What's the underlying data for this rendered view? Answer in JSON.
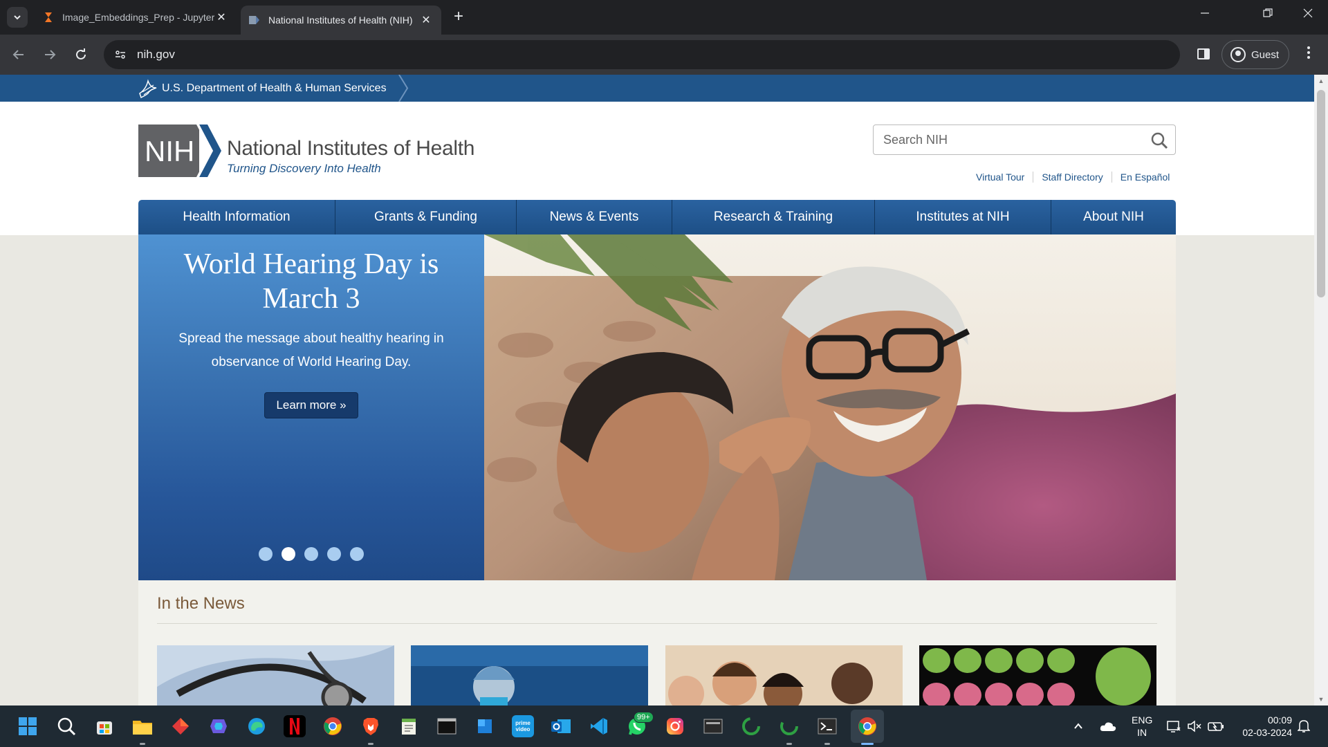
{
  "browser": {
    "tabs": [
      {
        "title": "Image_Embeddings_Prep - Jupyter",
        "close": "✕",
        "active": false
      },
      {
        "title": "National Institutes of Health (NIH)",
        "close": "✕",
        "active": true
      }
    ],
    "new_tab": "+",
    "url": "nih.gov",
    "profile": "Guest",
    "window_controls": {
      "minimize": "—",
      "restore": "❐",
      "close": "✕"
    }
  },
  "page": {
    "hhs_link": "U.S. Department of Health & Human Services",
    "logo": {
      "mark": "NIH",
      "name": "National Institutes of Health",
      "tagline": "Turning Discovery Into Health"
    },
    "search": {
      "placeholder": "Search NIH"
    },
    "util_links": [
      "Virtual Tour",
      "Staff Directory",
      "En Español"
    ],
    "nav": [
      "Health Information",
      "Grants & Funding",
      "News & Events",
      "Research & Training",
      "Institutes at NIH",
      "About NIH"
    ],
    "hero": {
      "title": "World Hearing Day is March 3",
      "text": "Spread the message about healthy hearing in observance of World Hearing Day.",
      "button": "Learn more »",
      "slide_count": 5,
      "active_slide": 2
    },
    "news": {
      "title": "In the News"
    }
  },
  "colors": {
    "hhs_blue": "#20558a",
    "nav_blue": "#1d4f86",
    "news_heading": "#7a5a3a"
  },
  "taskbar": {
    "icons": [
      "windows-start-icon",
      "search-icon",
      "store-icon",
      "file-explorer-icon",
      "app-icon",
      "copilot-icon",
      "edge-icon",
      "netflix-icon",
      "chrome-icon",
      "brave-icon",
      "notepad-icon",
      "terminal-icon",
      "app-icon",
      "prime-video-icon",
      "outlook-icon",
      "vscode-icon",
      "whatsapp-icon",
      "instagram-icon",
      "app-icon",
      "spinner-icon",
      "spinner-icon",
      "powershell-icon",
      "chrome-icon"
    ],
    "whatsapp_badge": "99+",
    "language": "ENG",
    "region": "IN",
    "time": "00:09",
    "date": "02-03-2024"
  }
}
